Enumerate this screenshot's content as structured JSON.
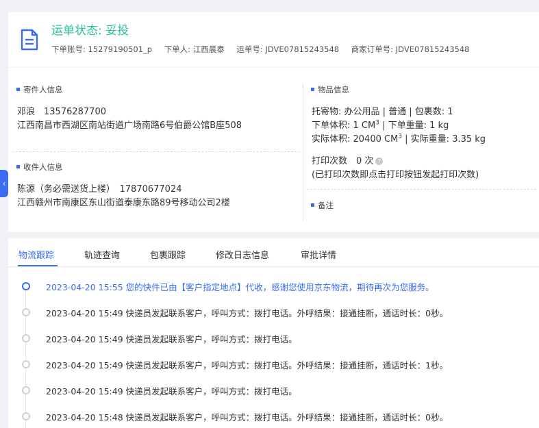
{
  "header": {
    "status_title": "运单状态: 妥投",
    "account": "下单账号: 15279190501_p",
    "orderer": "下单人: 江西晨泰",
    "waybill": "运单号: JDVE07815243548",
    "merchant_order": "商家订单号: JDVE07815243548"
  },
  "sender": {
    "title": "寄件人信息",
    "name_phone": "邓浪　13576287700",
    "address": "江西南昌市西湖区南站街道广场南路6号伯爵公馆B座508"
  },
  "receiver": {
    "title": "收件人信息",
    "name_phone": "陈源（务必需送货上楼）　17870677024",
    "address": "江西赣州市南康区东山街道泰康东路89号移动公司2楼"
  },
  "goods": {
    "title": "物品信息",
    "line1": "托寄物: 办公用品 | 普通 | 包裹数:  1",
    "line2_a": "下单体积:   1 CM",
    "line2_b": "  |  下单重量:   1 kg",
    "line3_a": "实际体积:   20400 CM",
    "line3_b": "  |  实际重量:   3.35 kg",
    "sup": "3",
    "print_count": "打印次数　0 次",
    "print_note": "(已打印次数即点击打印按钮发起打印次数)",
    "help_glyph": "?"
  },
  "remark": {
    "title": "备注"
  },
  "side_toggle": "‹",
  "tabs": [
    "物流跟踪",
    "轨迹查询",
    "包裹跟踪",
    "修改日志信息",
    "审批详情"
  ],
  "timeline": [
    "2023-04-20 15:55 您的快件已由【客户指定地点】代收，感谢您使用京东物流，期待再次为您服务。",
    "2023-04-20 15:49 快递员发起联系客户，呼叫方式：拨打电话。外呼结果：接通挂断，通话时长：0秒。",
    "2023-04-20 15:49 快递员发起联系客户，呼叫方式：拨打电话。",
    "2023-04-20 15:49 快递员发起联系客户，呼叫方式：拨打电话。外呼结果：接通挂断，通话时长：1秒。",
    "2023-04-20 15:49 快递员发起联系客户，呼叫方式：拨打电话。",
    "2023-04-20 15:48 快递员发起联系客户，呼叫方式：拨打电话。外呼结果：接通挂断，通话时长：0秒。"
  ],
  "colors": {
    "accent": "#3a6cf0",
    "status": "#2ec0a0"
  }
}
